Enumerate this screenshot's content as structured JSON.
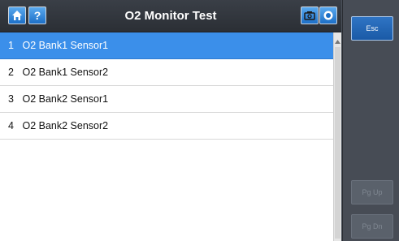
{
  "header": {
    "title": "O2 Monitor Test",
    "icons": [
      "home-icon",
      "help-icon",
      "camera-icon",
      "record-icon"
    ]
  },
  "list": {
    "items": [
      {
        "num": "1",
        "label": "O2 Bank1 Sensor1",
        "selected": true
      },
      {
        "num": "2",
        "label": "O2 Bank1 Sensor2",
        "selected": false
      },
      {
        "num": "3",
        "label": "O2 Bank2 Sensor1",
        "selected": false
      },
      {
        "num": "4",
        "label": "O2 Bank2 Sensor2",
        "selected": false
      }
    ]
  },
  "side_panel": {
    "esc_label": "Esc",
    "pg_up_label": "Pg Up",
    "pg_dn_label": "Pg Dn"
  },
  "colors": {
    "accent": "#3b8fea",
    "panel": "#474c55",
    "titlebar": "#2b2f35"
  }
}
